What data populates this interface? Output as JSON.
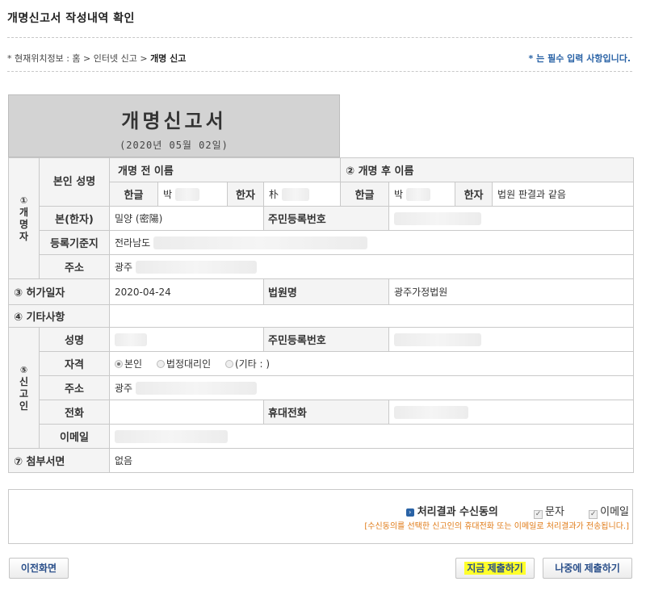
{
  "page_title": "개명신고서 작성내역 확인",
  "breadcrumb": {
    "prefix": "* 현재위치정보 : 홈 > 인터넷 신고 > ",
    "current": "개명 신고"
  },
  "required_note": "* 는 필수 입력 사항입니다.",
  "form_header": {
    "title": "개명신고서",
    "date": "(2020년 05월 02일)"
  },
  "section1": {
    "label_num": "①",
    "label": "개명자",
    "name_label": "본인 성명",
    "before_header": "개명 전 이름",
    "after_header": "② 개명 후 이름",
    "hangul_label": "한글",
    "hanja_label": "한자",
    "before_hangul": "박",
    "before_hanja": "朴",
    "after_hangul": "박",
    "after_hanja": "법원 판결과 같음",
    "bon_label": "본(한자)",
    "bon_value": "밀양 (密陽)",
    "rrn_label": "주민등록번호",
    "registry_label": "등록기준지",
    "registry_value": "전라남도",
    "address_label": "주소",
    "address_value": "광주"
  },
  "section3": {
    "label": "③ 허가일자",
    "date_value": "2020-04-24",
    "court_label": "법원명",
    "court_value": "광주가정법원"
  },
  "section4": {
    "label": "④ 기타사항"
  },
  "section5": {
    "label_num": "⑤",
    "label": "신고인",
    "name_label": "성명",
    "rrn_label": "주민등록번호",
    "qual_label": "자격",
    "qual_options": [
      "본인",
      "법정대리인",
      "(기타 : )"
    ],
    "address_label": "주소",
    "address_value": "광주",
    "phone_label": "전화",
    "mobile_label": "휴대전화",
    "email_label": "이메일"
  },
  "section7": {
    "label": "⑦ 첨부서면",
    "value": "없음"
  },
  "consent": {
    "heading": "처리결과 수신동의",
    "sms_label": "문자",
    "email_label": "이메일",
    "note": "[수신동의를 선택한 신고인의 휴대전화 또는 이메일로 처리결과가 전송됩니다.]"
  },
  "buttons": {
    "prev": "이전화면",
    "submit_now": "지금 제출하기",
    "submit_later": "나중에 제출하기"
  },
  "colors": {
    "accent_blue": "#2a63a6",
    "note_orange": "#e07b17",
    "highlight": "#ffff2a"
  }
}
